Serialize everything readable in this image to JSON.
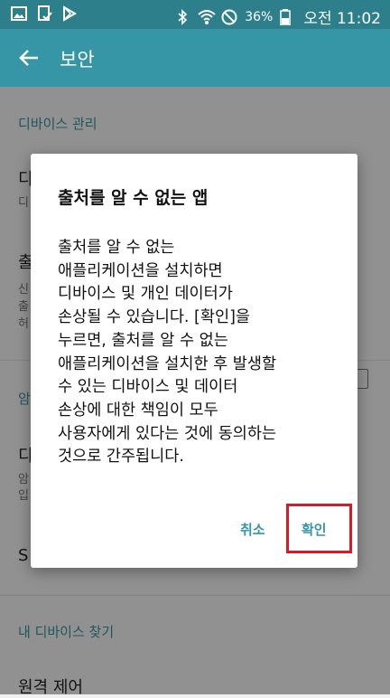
{
  "status_bar": {
    "battery": "36%",
    "time": "오전 11:02",
    "icons": [
      "gallery-icon",
      "document-icon",
      "playstore-icon",
      "bluetooth-icon",
      "wifi-icon",
      "no-sound-icon",
      "battery-icon"
    ]
  },
  "app_bar": {
    "title": "보안",
    "back_icon": "back-arrow-icon"
  },
  "settings": {
    "section_device_admin": "디바이스 관리",
    "item1_title": "디",
    "item1_sub": "디",
    "item2_title": "출",
    "item2_sub1": "신",
    "item2_sub2": "출",
    "item2_sub3": "허",
    "section_encryption": "암",
    "item3_title": "디",
    "item3_sub1": "암",
    "item3_sub2": "입",
    "item4_title": "S",
    "section_find_device": "내 디바이스 찾기",
    "item5_title": "원격 제어"
  },
  "dialog": {
    "title": "출처를 알 수 없는 앱",
    "body_lines": [
      "출처를 알 수 없는",
      "애플리케이션을 설치하면",
      "디바이스 및 개인 데이터가",
      "손상될 수 있습니다. [확인]을",
      "누르면, 출처를 알 수 없는",
      "애플리케이션을 설치한 후 발생할",
      "수 있는 디바이스 및 데이터",
      "손상에 대한 책임이 모두",
      "사용자에게 있다는 것에 동의하는",
      "것으로 간주됩니다."
    ],
    "cancel_label": "취소",
    "ok_label": "확인"
  },
  "colors": {
    "status_bar": "#2e7f8c",
    "app_bar": "#3696a5",
    "accent": "#3696a5",
    "highlight": "#e6141e"
  }
}
